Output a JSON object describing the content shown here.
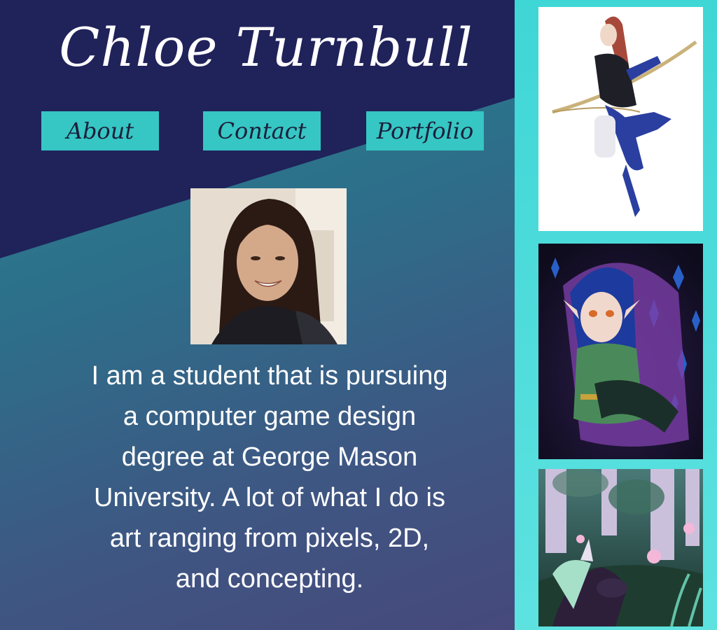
{
  "header": {
    "title": "Chloe Turnbull"
  },
  "nav": {
    "about": "About",
    "contact": "Contact",
    "portfolio": "Portfolio"
  },
  "bio": {
    "lines": [
      "I am a student that is pursuing",
      "a computer game design",
      "degree at George Mason",
      "University. A lot of what I do is",
      "art ranging from pixels, 2D,",
      "and concepting."
    ]
  },
  "colors": {
    "navy": "#20225a",
    "teal_nav": "#36c6c4",
    "gallery_cyan": "#4fdcdb",
    "text_white": "#ffffff"
  },
  "gallery": {
    "items": [
      "archer-artwork",
      "elf-artwork",
      "forest-unicorn-artwork"
    ]
  }
}
